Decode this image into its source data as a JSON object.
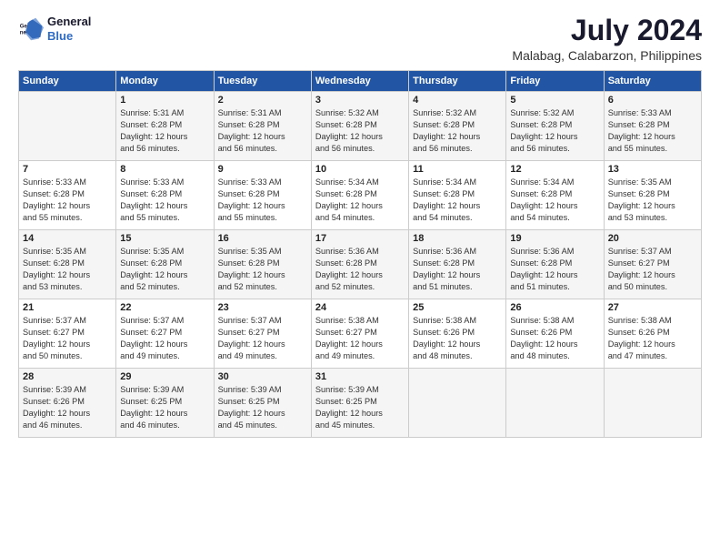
{
  "logo": {
    "line1": "General",
    "line2": "Blue"
  },
  "title": "July 2024",
  "subtitle": "Malabag, Calabarzon, Philippines",
  "header": {
    "days": [
      "Sunday",
      "Monday",
      "Tuesday",
      "Wednesday",
      "Thursday",
      "Friday",
      "Saturday"
    ]
  },
  "weeks": [
    {
      "cells": [
        {
          "day": "",
          "info": ""
        },
        {
          "day": "1",
          "info": "Sunrise: 5:31 AM\nSunset: 6:28 PM\nDaylight: 12 hours\nand 56 minutes."
        },
        {
          "day": "2",
          "info": "Sunrise: 5:31 AM\nSunset: 6:28 PM\nDaylight: 12 hours\nand 56 minutes."
        },
        {
          "day": "3",
          "info": "Sunrise: 5:32 AM\nSunset: 6:28 PM\nDaylight: 12 hours\nand 56 minutes."
        },
        {
          "day": "4",
          "info": "Sunrise: 5:32 AM\nSunset: 6:28 PM\nDaylight: 12 hours\nand 56 minutes."
        },
        {
          "day": "5",
          "info": "Sunrise: 5:32 AM\nSunset: 6:28 PM\nDaylight: 12 hours\nand 56 minutes."
        },
        {
          "day": "6",
          "info": "Sunrise: 5:33 AM\nSunset: 6:28 PM\nDaylight: 12 hours\nand 55 minutes."
        }
      ]
    },
    {
      "cells": [
        {
          "day": "7",
          "info": "Sunrise: 5:33 AM\nSunset: 6:28 PM\nDaylight: 12 hours\nand 55 minutes."
        },
        {
          "day": "8",
          "info": "Sunrise: 5:33 AM\nSunset: 6:28 PM\nDaylight: 12 hours\nand 55 minutes."
        },
        {
          "day": "9",
          "info": "Sunrise: 5:33 AM\nSunset: 6:28 PM\nDaylight: 12 hours\nand 55 minutes."
        },
        {
          "day": "10",
          "info": "Sunrise: 5:34 AM\nSunset: 6:28 PM\nDaylight: 12 hours\nand 54 minutes."
        },
        {
          "day": "11",
          "info": "Sunrise: 5:34 AM\nSunset: 6:28 PM\nDaylight: 12 hours\nand 54 minutes."
        },
        {
          "day": "12",
          "info": "Sunrise: 5:34 AM\nSunset: 6:28 PM\nDaylight: 12 hours\nand 54 minutes."
        },
        {
          "day": "13",
          "info": "Sunrise: 5:35 AM\nSunset: 6:28 PM\nDaylight: 12 hours\nand 53 minutes."
        }
      ]
    },
    {
      "cells": [
        {
          "day": "14",
          "info": "Sunrise: 5:35 AM\nSunset: 6:28 PM\nDaylight: 12 hours\nand 53 minutes."
        },
        {
          "day": "15",
          "info": "Sunrise: 5:35 AM\nSunset: 6:28 PM\nDaylight: 12 hours\nand 52 minutes."
        },
        {
          "day": "16",
          "info": "Sunrise: 5:35 AM\nSunset: 6:28 PM\nDaylight: 12 hours\nand 52 minutes."
        },
        {
          "day": "17",
          "info": "Sunrise: 5:36 AM\nSunset: 6:28 PM\nDaylight: 12 hours\nand 52 minutes."
        },
        {
          "day": "18",
          "info": "Sunrise: 5:36 AM\nSunset: 6:28 PM\nDaylight: 12 hours\nand 51 minutes."
        },
        {
          "day": "19",
          "info": "Sunrise: 5:36 AM\nSunset: 6:28 PM\nDaylight: 12 hours\nand 51 minutes."
        },
        {
          "day": "20",
          "info": "Sunrise: 5:37 AM\nSunset: 6:27 PM\nDaylight: 12 hours\nand 50 minutes."
        }
      ]
    },
    {
      "cells": [
        {
          "day": "21",
          "info": "Sunrise: 5:37 AM\nSunset: 6:27 PM\nDaylight: 12 hours\nand 50 minutes."
        },
        {
          "day": "22",
          "info": "Sunrise: 5:37 AM\nSunset: 6:27 PM\nDaylight: 12 hours\nand 49 minutes."
        },
        {
          "day": "23",
          "info": "Sunrise: 5:37 AM\nSunset: 6:27 PM\nDaylight: 12 hours\nand 49 minutes."
        },
        {
          "day": "24",
          "info": "Sunrise: 5:38 AM\nSunset: 6:27 PM\nDaylight: 12 hours\nand 49 minutes."
        },
        {
          "day": "25",
          "info": "Sunrise: 5:38 AM\nSunset: 6:26 PM\nDaylight: 12 hours\nand 48 minutes."
        },
        {
          "day": "26",
          "info": "Sunrise: 5:38 AM\nSunset: 6:26 PM\nDaylight: 12 hours\nand 48 minutes."
        },
        {
          "day": "27",
          "info": "Sunrise: 5:38 AM\nSunset: 6:26 PM\nDaylight: 12 hours\nand 47 minutes."
        }
      ]
    },
    {
      "cells": [
        {
          "day": "28",
          "info": "Sunrise: 5:39 AM\nSunset: 6:26 PM\nDaylight: 12 hours\nand 46 minutes."
        },
        {
          "day": "29",
          "info": "Sunrise: 5:39 AM\nSunset: 6:25 PM\nDaylight: 12 hours\nand 46 minutes."
        },
        {
          "day": "30",
          "info": "Sunrise: 5:39 AM\nSunset: 6:25 PM\nDaylight: 12 hours\nand 45 minutes."
        },
        {
          "day": "31",
          "info": "Sunrise: 5:39 AM\nSunset: 6:25 PM\nDaylight: 12 hours\nand 45 minutes."
        },
        {
          "day": "",
          "info": ""
        },
        {
          "day": "",
          "info": ""
        },
        {
          "day": "",
          "info": ""
        }
      ]
    }
  ]
}
